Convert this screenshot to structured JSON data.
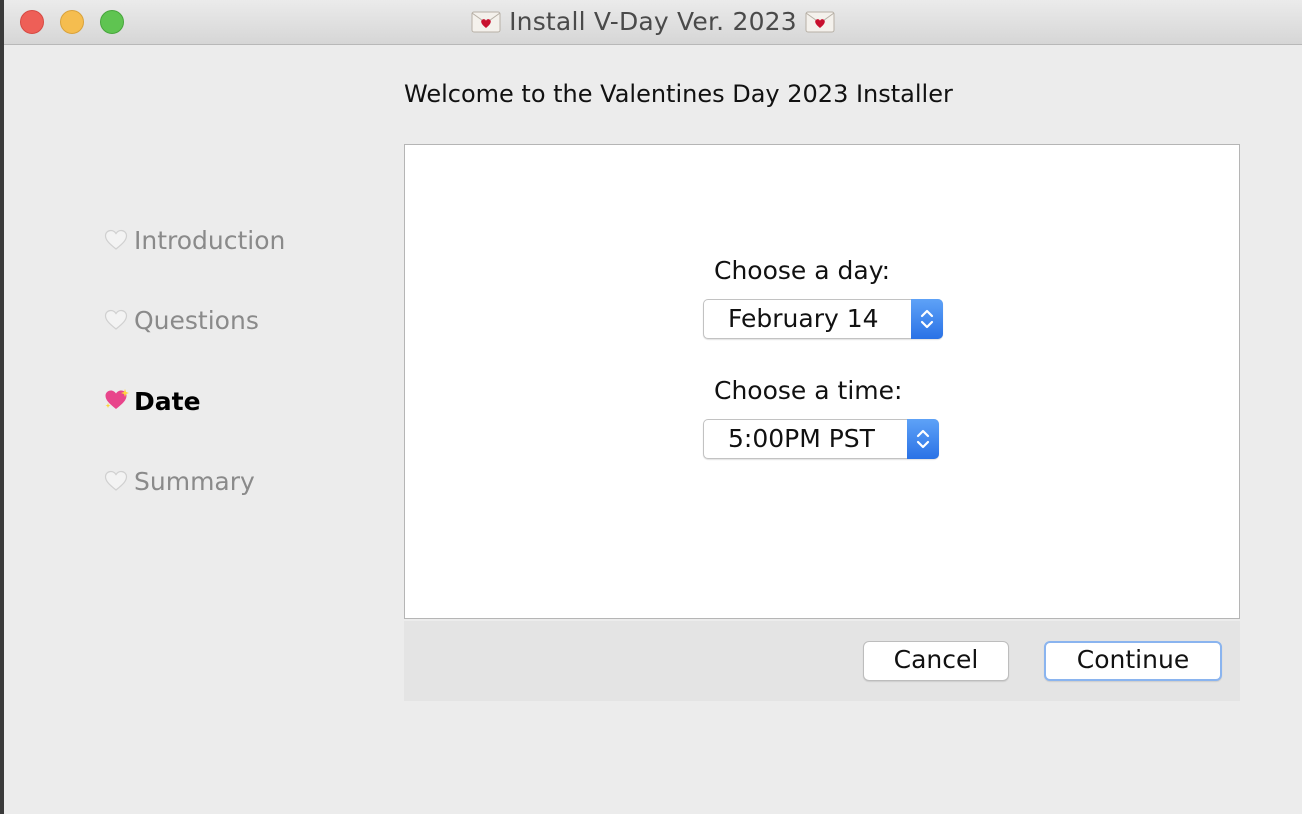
{
  "window": {
    "title": "Install V-Day Ver. 2023"
  },
  "header": {
    "welcome": "Welcome to the Valentines Day 2023 Installer"
  },
  "sidebar": {
    "steps": [
      {
        "label": "Introduction",
        "icon": "white-heart-icon",
        "active": false
      },
      {
        "label": "Questions",
        "icon": "white-heart-icon",
        "active": false
      },
      {
        "label": "Date",
        "icon": "sparkling-heart-icon",
        "active": true
      },
      {
        "label": "Summary",
        "icon": "white-heart-icon",
        "active": false
      }
    ]
  },
  "form": {
    "day_label": "Choose a day:",
    "day_value": "February 14",
    "time_label": "Choose a time:",
    "time_value": "5:00PM PST"
  },
  "buttons": {
    "cancel": "Cancel",
    "continue": "Continue"
  },
  "colors": {
    "accent": "#2a72e6",
    "active_heart": "#e8458b",
    "envelope_heart": "#c8102e"
  }
}
